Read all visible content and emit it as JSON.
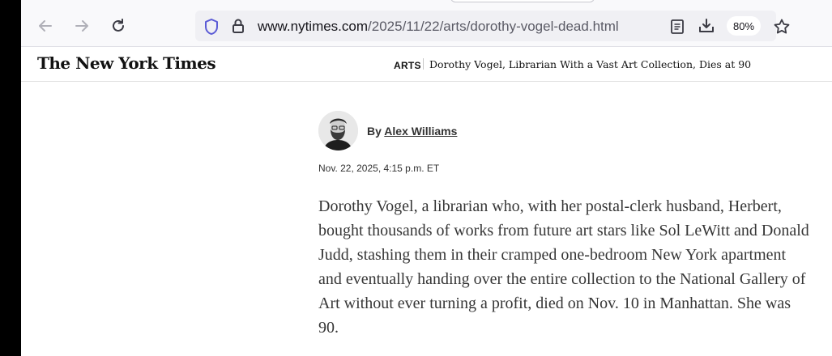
{
  "browser": {
    "url_domain": "www.nytimes.com",
    "url_path": "/2025/11/22/arts/dorothy-vogel-dead.html",
    "zoom_level": "80%"
  },
  "site_header": {
    "logo_text": "The New York Times",
    "section": "ARTS",
    "headline": "Dorothy Vogel, Librarian With a Vast Art Collection, Dies at 90"
  },
  "article": {
    "byline_prefix": "By",
    "author": "Alex Williams",
    "timestamp": "Nov. 22, 2025, 4:15 p.m. ET",
    "paragraph": "Dorothy Vogel, a librarian who, with her postal-clerk husband, Herbert, bought thousands of works from future art stars like Sol LeWitt and Donald Judd, stashing them in their cramped one-bedroom New York apartment and eventually handing over the entire collection to the National Gallery of Art without ever turning a profit, died on Nov. 10 in Manhattan. She was 90."
  }
}
